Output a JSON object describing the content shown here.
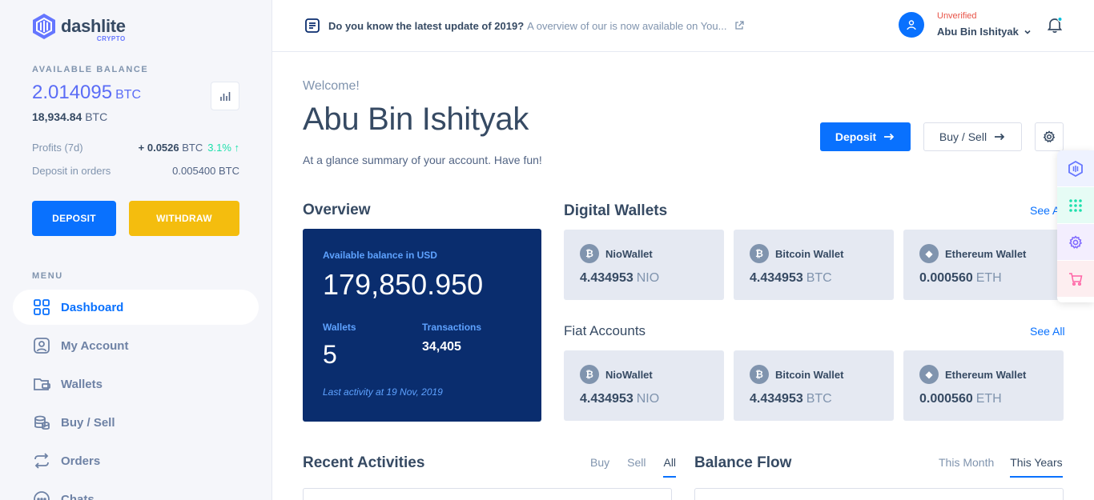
{
  "brand": {
    "name": "dashlite",
    "sub": "CRYPTO"
  },
  "sidebar": {
    "balance_label": "AVAILABLE BALANCE",
    "balance_btc": "2.014095",
    "balance_unit": "BTC",
    "balance_usd": "18,934.84",
    "balance_usd_unit": "BTC",
    "profits_label": "Profits (7d)",
    "profits_value": "+ 0.0526",
    "profits_unit": "BTC",
    "profits_change": "3.1% ↑",
    "orders_label": "Deposit in orders",
    "orders_value": "0.005400 BTC",
    "deposit_label": "DEPOSIT",
    "withdraw_label": "WITHDRAW",
    "menu_label": "MENU",
    "menu": [
      {
        "label": "Dashboard",
        "icon": "dashboard-icon",
        "active": true
      },
      {
        "label": "My Account",
        "icon": "user-icon"
      },
      {
        "label": "Wallets",
        "icon": "wallet-icon"
      },
      {
        "label": "Buy / Sell",
        "icon": "coins-icon"
      },
      {
        "label": "Orders",
        "icon": "repeat-icon"
      },
      {
        "label": "Chats",
        "icon": "chat-icon"
      }
    ]
  },
  "header": {
    "news_title": "Do you know the latest update of 2019?",
    "news_text": "A overview of our is now available on You...",
    "user_status": "Unverified",
    "user_name": "Abu Bin Ishityak"
  },
  "main": {
    "welcome": "Welcome!",
    "title": "Abu Bin Ishityak",
    "desc": "At a glance summary of your account. Have fun!",
    "deposit_btn": "Deposit",
    "buysell_btn": "Buy / Sell",
    "overview": {
      "title": "Overview",
      "available_label": "Available balance in USD",
      "available_value": "179,850.950",
      "wallets_label": "Wallets",
      "wallets_value": "5",
      "transactions_label": "Transactions",
      "transactions_value": "34,405",
      "last_activity": "Last activity at 19 Nov, 2019"
    },
    "digital_wallets": {
      "title": "Digital Wallets",
      "see_all": "See All",
      "items": [
        {
          "name": "NioWallet",
          "amount": "4.434953",
          "unit": "NIO",
          "coin": "bitcoin-icon"
        },
        {
          "name": "Bitcoin Wallet",
          "amount": "4.434953",
          "unit": "BTC",
          "coin": "bitcoin-icon"
        },
        {
          "name": "Ethereum Wallet",
          "amount": "0.000560",
          "unit": "ETH",
          "coin": "ethereum-icon"
        }
      ]
    },
    "fiat_accounts": {
      "title": "Fiat Accounts",
      "see_all": "See All",
      "items": [
        {
          "name": "NioWallet",
          "amount": "4.434953",
          "unit": "NIO",
          "coin": "bitcoin-icon"
        },
        {
          "name": "Bitcoin Wallet",
          "amount": "4.434953",
          "unit": "BTC",
          "coin": "bitcoin-icon"
        },
        {
          "name": "Ethereum Wallet",
          "amount": "0.000560",
          "unit": "ETH",
          "coin": "ethereum-icon"
        }
      ]
    },
    "recent": {
      "title": "Recent Activities",
      "tabs": [
        "Buy",
        "Sell",
        "All"
      ]
    },
    "balance_flow": {
      "title": "Balance Flow",
      "tabs": [
        "This Month",
        "This Years"
      ]
    }
  },
  "colors": {
    "primary": "#0971fe",
    "warning": "#f4bd0e",
    "navy": "#0a2d6e",
    "success": "#1ee0ac",
    "danger": "#e85347"
  }
}
